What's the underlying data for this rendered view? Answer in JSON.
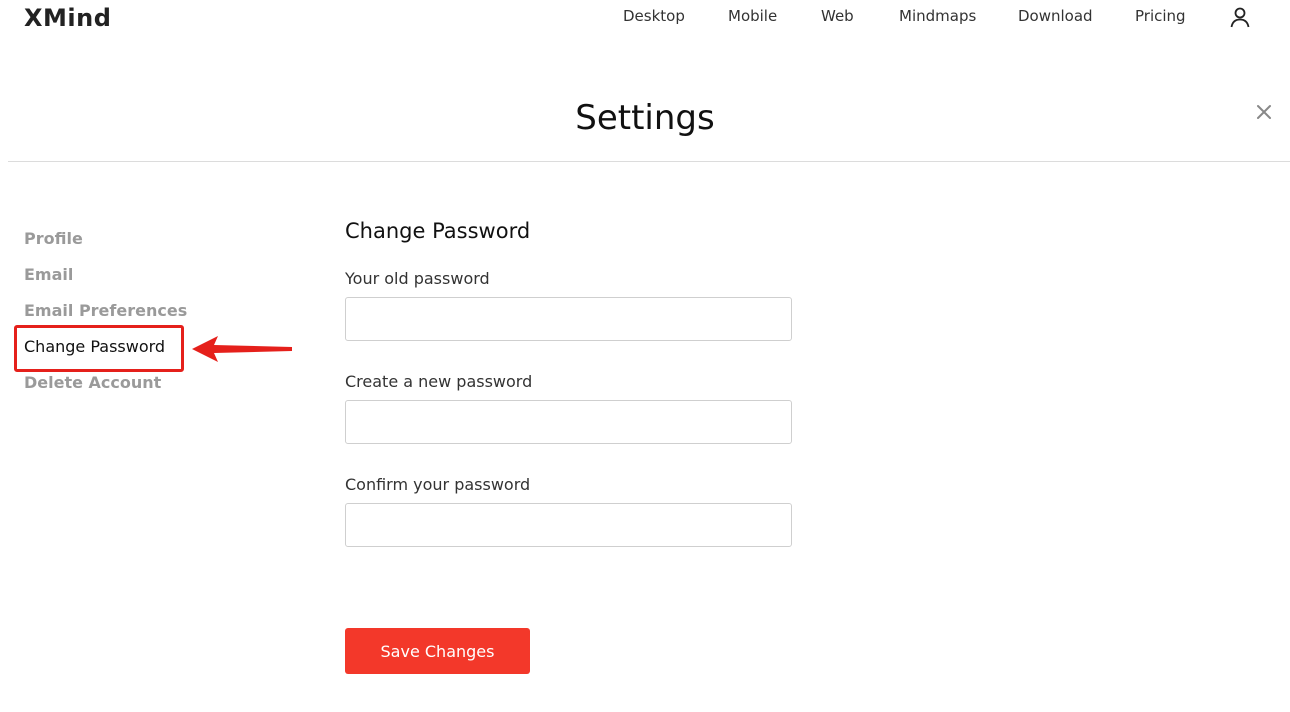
{
  "header": {
    "logo": "XMind",
    "nav": [
      {
        "label": "Desktop"
      },
      {
        "label": "Mobile"
      },
      {
        "label": "Web"
      },
      {
        "label": "Mindmaps"
      },
      {
        "label": "Download"
      },
      {
        "label": "Pricing"
      }
    ],
    "user_icon": "user-icon"
  },
  "settings": {
    "title": "Settings",
    "close_icon": "close-icon"
  },
  "sidebar": {
    "items": [
      {
        "label": "Profile",
        "active": false
      },
      {
        "label": "Email",
        "active": false
      },
      {
        "label": "Email Preferences",
        "active": false
      },
      {
        "label": "Change Password",
        "active": true
      },
      {
        "label": "Delete Account",
        "active": false
      }
    ]
  },
  "form": {
    "title": "Change Password",
    "fields": [
      {
        "label": "Your old password",
        "value": ""
      },
      {
        "label": "Create a new password",
        "value": ""
      },
      {
        "label": "Confirm your password",
        "value": ""
      }
    ],
    "save_label": "Save Changes"
  },
  "colors": {
    "accent": "#f3382a",
    "annotation": "#e5201b"
  }
}
